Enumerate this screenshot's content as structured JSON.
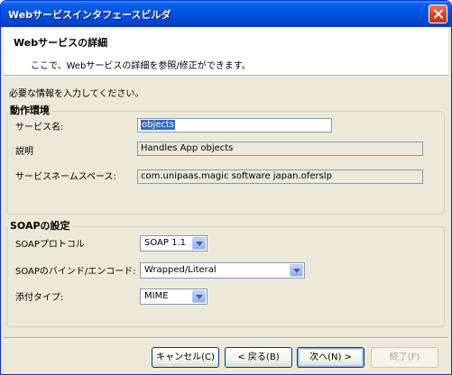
{
  "window": {
    "title": "Webサービスインタフェースビルダ"
  },
  "header": {
    "title": "Webサービスの詳細",
    "subtitle": "ここで、Webサービスの詳細を参照/修正ができます。"
  },
  "intro": "必要な情報を入力してください。",
  "operation_env": {
    "group_label": "動作環境",
    "service_name_label": "サービス名:",
    "service_name_value": "objects",
    "description_label": "説明",
    "description_value": "Handles App objects",
    "namespace_label": "サービスネームスペース:",
    "namespace_value": "com.unipaas.magic software japan.oferslp"
  },
  "soap": {
    "group_label": "SOAPの設定",
    "protocol_label": "SOAPプロトコル",
    "protocol_value": "SOAP 1.1",
    "binding_label": "SOAPのバインド/エンコード:",
    "binding_value": "Wrapped/Literal",
    "attachment_label": "添付タイプ:",
    "attachment_value": "MIME"
  },
  "buttons": {
    "cancel": "キャンセル(C)",
    "back": "< 戻る(B)",
    "next": "次へ(N) >",
    "finish": "終了(F)"
  }
}
